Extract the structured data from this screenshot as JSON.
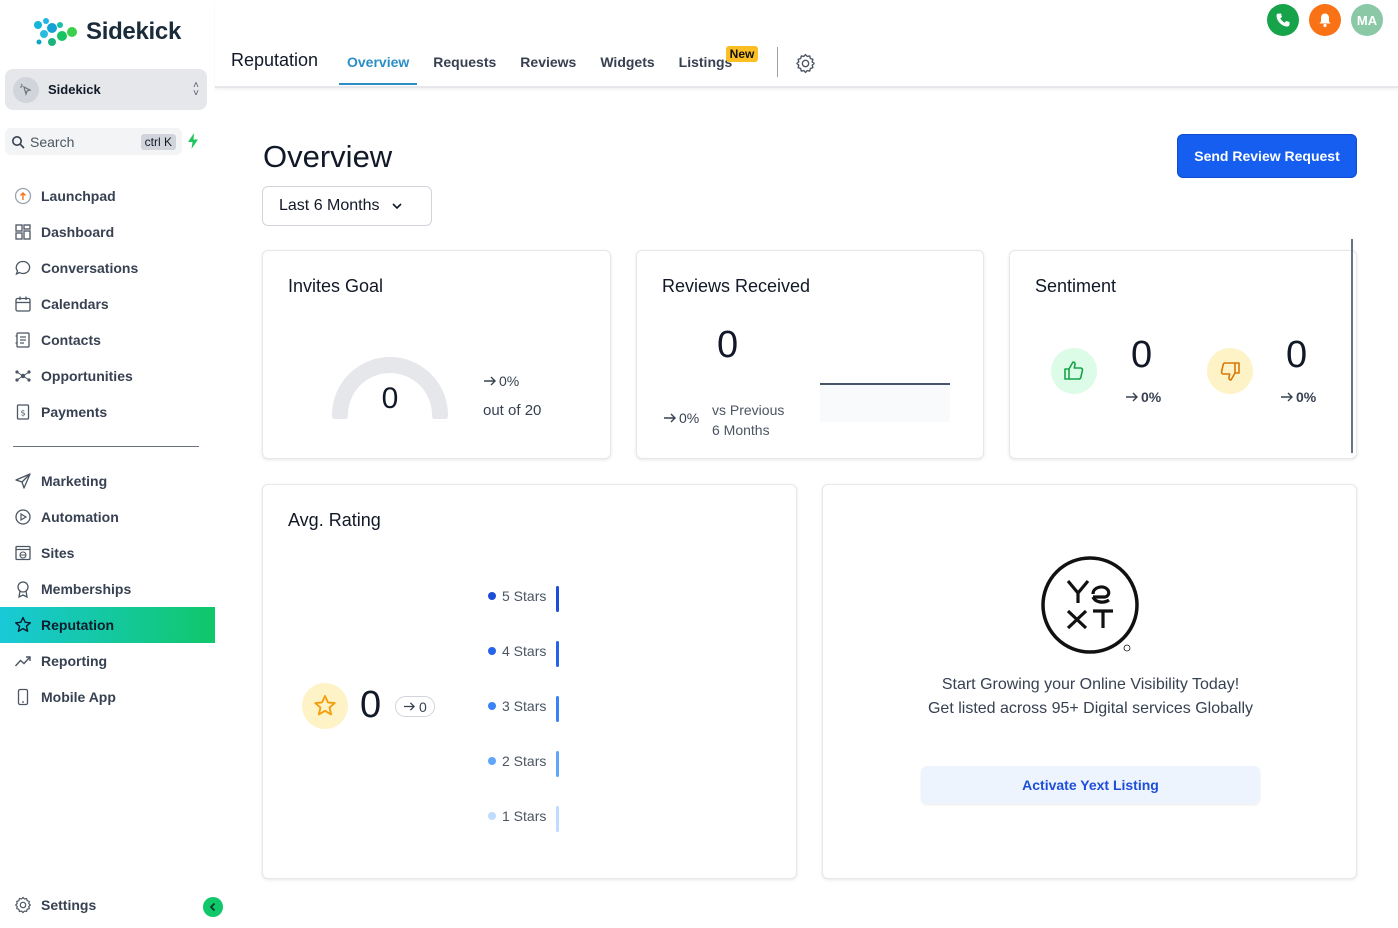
{
  "brand": {
    "name": "Sidekick"
  },
  "account": {
    "name": "Sidekick"
  },
  "search": {
    "label": "Search",
    "shortcut": "ctrl K"
  },
  "sidebar": {
    "items": [
      {
        "label": "Launchpad",
        "icon": "launchpad-icon"
      },
      {
        "label": "Dashboard",
        "icon": "dashboard-icon"
      },
      {
        "label": "Conversations",
        "icon": "chat-icon"
      },
      {
        "label": "Calendars",
        "icon": "calendar-icon"
      },
      {
        "label": "Contacts",
        "icon": "contacts-icon"
      },
      {
        "label": "Opportunities",
        "icon": "opportunities-icon"
      },
      {
        "label": "Payments",
        "icon": "payments-icon"
      }
    ],
    "items2": [
      {
        "label": "Marketing",
        "icon": "send-icon"
      },
      {
        "label": "Automation",
        "icon": "automation-icon"
      },
      {
        "label": "Sites",
        "icon": "sites-icon"
      },
      {
        "label": "Memberships",
        "icon": "membership-icon"
      },
      {
        "label": "Reputation",
        "icon": "star-icon",
        "active": true
      },
      {
        "label": "Reporting",
        "icon": "reporting-icon"
      },
      {
        "label": "Mobile App",
        "icon": "mobile-icon"
      }
    ],
    "settings_label": "Settings"
  },
  "header": {
    "title": "Reputation",
    "tabs": [
      {
        "label": "Overview",
        "active": true
      },
      {
        "label": "Requests"
      },
      {
        "label": "Reviews"
      },
      {
        "label": "Widgets"
      },
      {
        "label": "Listings",
        "badge": "New"
      }
    ],
    "avatar_initials": "MA"
  },
  "main": {
    "title": "Overview",
    "range": "Last 6 Months",
    "primary_action": "Send Review Request",
    "invites_goal": {
      "title": "Invites Goal",
      "value": "0",
      "change": "0%",
      "out_of": "out of 20"
    },
    "reviews_received": {
      "title": "Reviews Received",
      "value": "0",
      "change": "0%",
      "vs_line1": "vs Previous",
      "vs_line2": "6 Months"
    },
    "sentiment": {
      "title": "Sentiment",
      "positive": "0",
      "positive_change": "0%",
      "negative": "0",
      "negative_change": "0%"
    },
    "avg_rating": {
      "title": "Avg. Rating",
      "value": "0",
      "change": "0",
      "rows": [
        {
          "label": "5 Stars",
          "color": "#1d4ed8"
        },
        {
          "label": "4 Stars",
          "color": "#2563eb"
        },
        {
          "label": "3 Stars",
          "color": "#3b82f6"
        },
        {
          "label": "2 Stars",
          "color": "#60a5fa"
        },
        {
          "label": "1 Stars",
          "color": "#bfdbfe"
        }
      ]
    },
    "yext": {
      "line1": "Start Growing your Online Visibility Today!",
      "line2": "Get listed across 95+ Digital services Globally",
      "cta": "Activate Yext Listing"
    }
  },
  "colors": {
    "accent": "#155eef",
    "active_tab": "#2a8fc6",
    "active_nav_start": "#19c9d8",
    "active_nav_end": "#10c76a"
  }
}
